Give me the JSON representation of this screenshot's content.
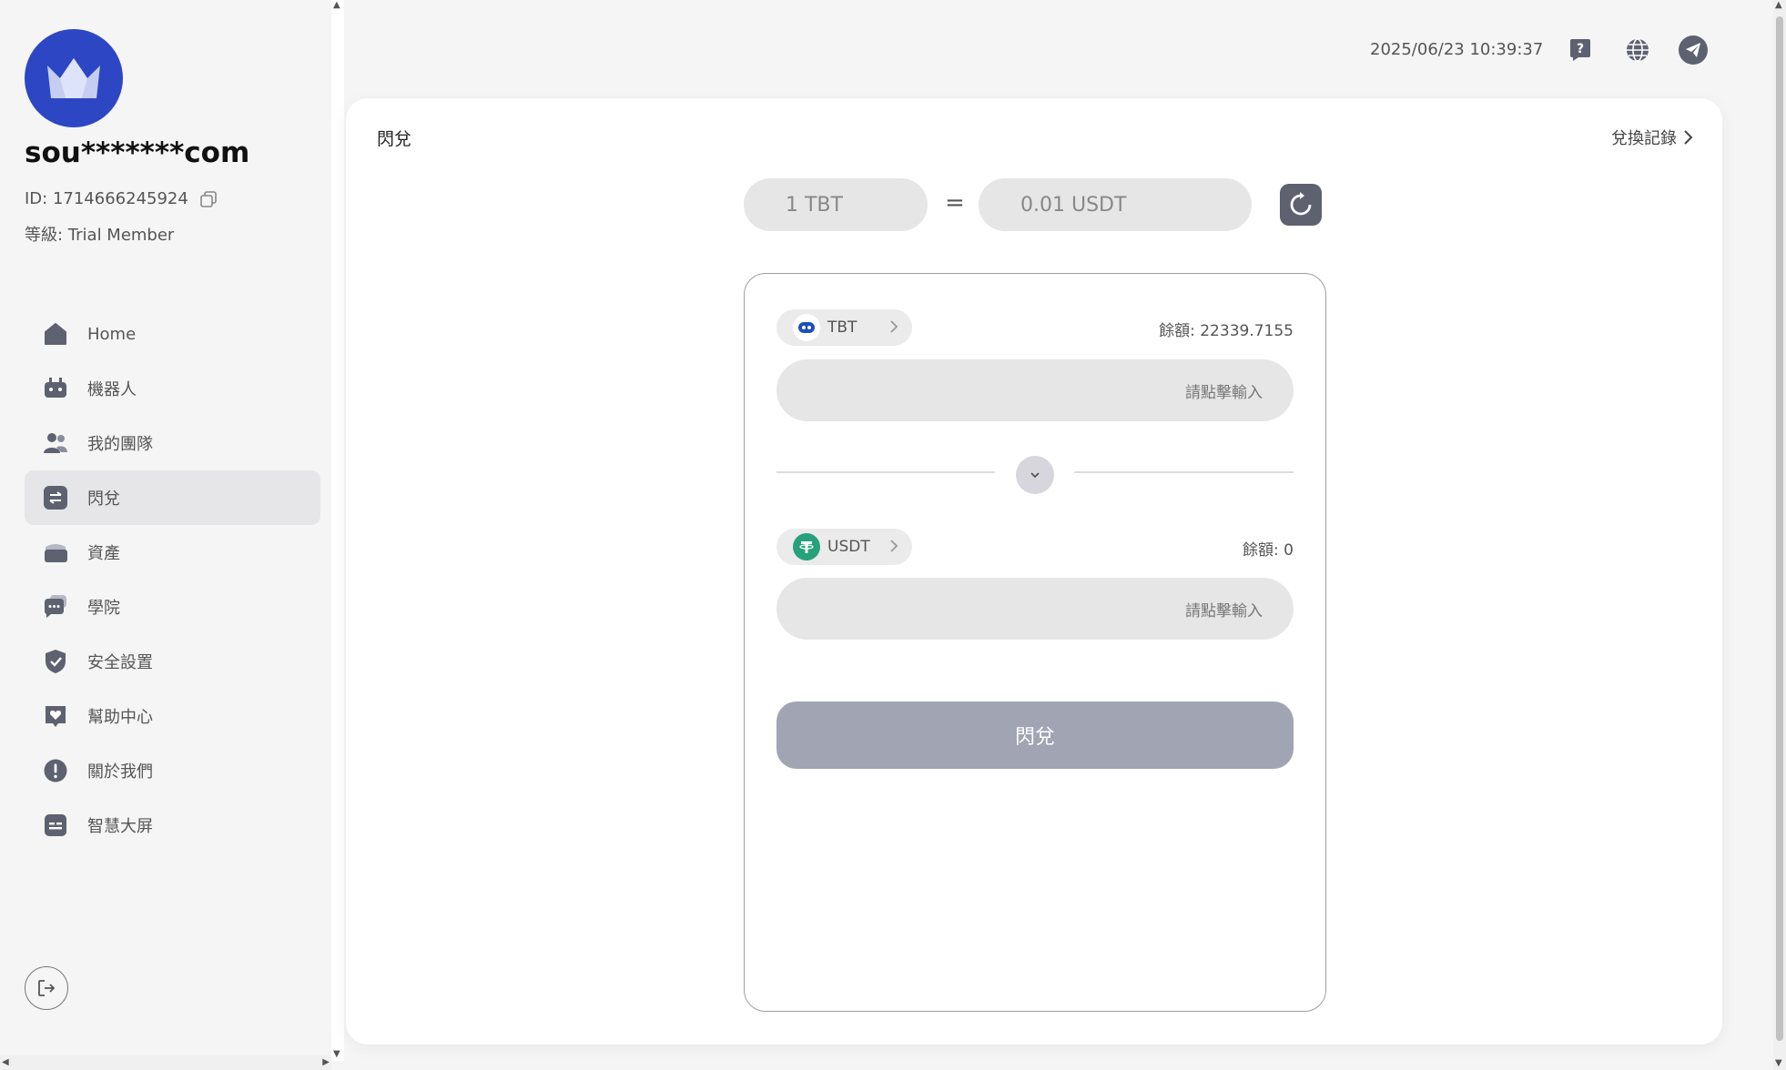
{
  "user": {
    "name": "sou*******com",
    "id_label": "ID: 1714666245924",
    "level_label": "等級: Trial Member"
  },
  "nav": {
    "items": [
      {
        "label": "Home",
        "icon": "home-icon"
      },
      {
        "label": "機器人",
        "icon": "robot-icon"
      },
      {
        "label": "我的團隊",
        "icon": "team-icon"
      },
      {
        "label": "閃兌",
        "icon": "swap-icon",
        "active": true
      },
      {
        "label": "資產",
        "icon": "wallet-icon"
      },
      {
        "label": "學院",
        "icon": "chat-icon"
      },
      {
        "label": "安全設置",
        "icon": "shield-icon"
      },
      {
        "label": "幫助中心",
        "icon": "heart-icon"
      },
      {
        "label": "關於我們",
        "icon": "info-icon"
      },
      {
        "label": "智慧大屏",
        "icon": "screen-icon"
      }
    ]
  },
  "header": {
    "datetime": "2025/06/23 10:39:37"
  },
  "page": {
    "title": "閃兌",
    "history_link": "兌換記錄"
  },
  "rate": {
    "from": "1 TBT",
    "equals": "=",
    "to": "0.01 USDT"
  },
  "swap": {
    "from_token": "TBT",
    "from_balance": "餘額: 22339.7155",
    "from_placeholder": "請點擊輸入",
    "to_token": "USDT",
    "to_balance": "餘額: 0",
    "to_placeholder": "請點擊輸入",
    "submit_label": "閃兌"
  },
  "colors": {
    "accent": "#2d46c4",
    "icon": "#5d6170",
    "tbt": "#1f4fb5",
    "usdt": "#26a17b",
    "button_disabled": "#a0a4b3"
  }
}
